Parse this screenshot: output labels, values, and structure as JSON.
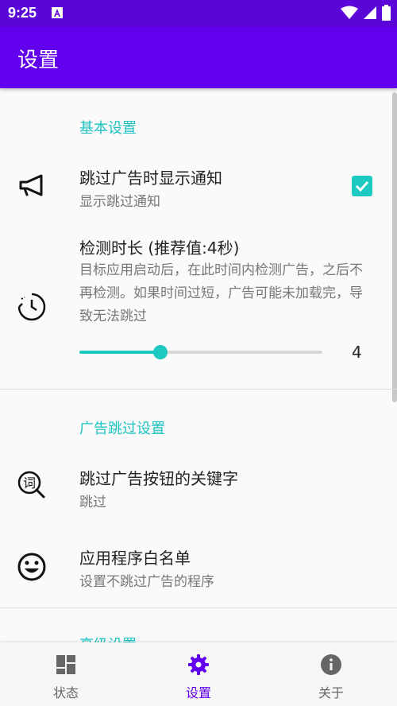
{
  "status_bar": {
    "time": "9:25",
    "icons": [
      "notification-a-icon",
      "wifi-icon",
      "cellular-icon",
      "battery-icon"
    ]
  },
  "app_bar": {
    "title": "设置"
  },
  "sections": [
    {
      "title": "基本设置",
      "items": [
        {
          "icon": "megaphone-icon",
          "title": "跳过广告时显示通知",
          "subtitle": "显示跳过通知",
          "checked": true
        },
        {
          "icon": "timer-icon",
          "title": "检测时长 (推荐值:4秒)",
          "description": "目标应用启动后，在此时间内检测广告，之后不再检测。如果时间过短，广告可能未加载完，导致无法跳过",
          "slider_value": "4",
          "slider_fraction": 0.333
        }
      ]
    },
    {
      "title": "广告跳过设置",
      "items": [
        {
          "icon": "keyword-search-icon",
          "title": "跳过广告按钮的关键字",
          "subtitle": "跳过"
        },
        {
          "icon": "smiley-icon",
          "title": "应用程序白名单",
          "subtitle": "设置不跳过广告的程序"
        }
      ]
    },
    {
      "title": "高级设置"
    }
  ],
  "bottom_nav": {
    "items": [
      {
        "icon": "dashboard-icon",
        "label": "状态",
        "active": false
      },
      {
        "icon": "gear-icon",
        "label": "设置",
        "active": true
      },
      {
        "icon": "info-icon",
        "label": "关于",
        "active": false
      }
    ]
  },
  "colors": {
    "primary": "#6200ee",
    "status_bar": "#5b06d8",
    "accent": "#1dc9c0"
  }
}
